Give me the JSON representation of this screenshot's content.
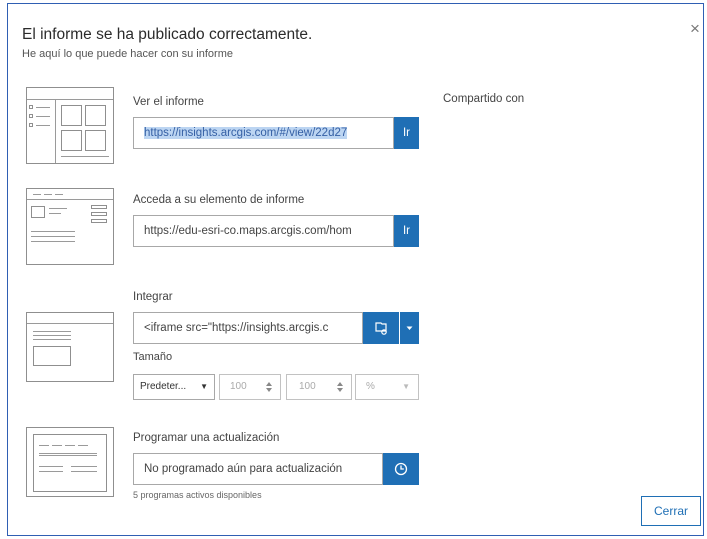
{
  "dialog": {
    "title": "El informe se ha publicado correctamente.",
    "subtitle": "He aquí lo que puede hacer con su informe",
    "close_icon": "×",
    "close_button_label": "Cerrar"
  },
  "view_report": {
    "label": "Ver el informe",
    "url": "https://insights.arcgis.com/#/view/22d27",
    "go_label": "Ir"
  },
  "report_item": {
    "label": "Acceda a su elemento de informe",
    "url": "https://edu-esri-co.maps.arcgis.com/hom",
    "go_label": "Ir"
  },
  "shared_with_label": "Compartido con",
  "embed": {
    "label": "Integrar",
    "code": "<iframe src=\"https://insights.arcgis.c",
    "copy_icon": "copy-icon",
    "dropdown_icon": "caret-down-icon",
    "size_label": "Tamaño",
    "size_preset": "Predeter...",
    "width_value": "100",
    "height_value": "100",
    "unit": "%"
  },
  "schedule": {
    "label": "Programar una actualización",
    "value": "No programado aún para actualización",
    "clock_icon": "clock-icon",
    "note": "5 programas activos disponibles"
  },
  "colors": {
    "accent": "#1f6fb5",
    "frame_border": "#2f5fb3",
    "selection": "#bcd5f2"
  }
}
